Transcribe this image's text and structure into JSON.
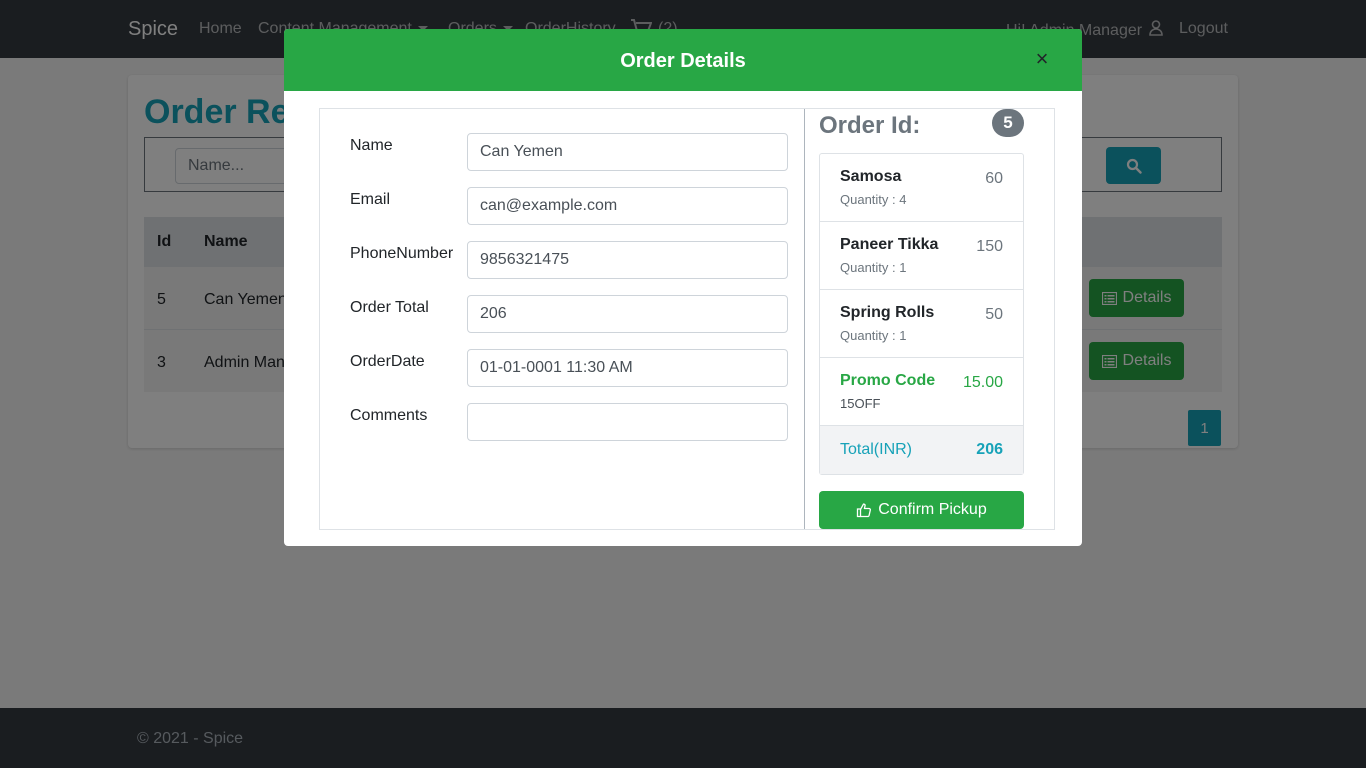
{
  "navbar": {
    "brand": "Spice",
    "links": [
      "Home",
      "Content Management",
      "Orders",
      "OrderHistory"
    ],
    "cart_count": "(2)",
    "user_greeting": "Hi! Admin Manager",
    "logout": "Logout"
  },
  "page": {
    "title": "Order Ready",
    "search_placeholder": "Name...",
    "table": {
      "headers": [
        "Id",
        "Name"
      ],
      "rows": [
        {
          "id": "5",
          "name": "Can Yemen",
          "action": "Details"
        },
        {
          "id": "3",
          "name": "Admin Manager",
          "action": "Details"
        }
      ]
    },
    "pagination": [
      "1"
    ]
  },
  "footer": {
    "text": "© 2021 - Spice"
  },
  "modal": {
    "title": "Order Details",
    "close": "×",
    "fields": [
      {
        "label": "Name",
        "value": "Can Yemen"
      },
      {
        "label": "Email",
        "value": "can@example.com"
      },
      {
        "label": "PhoneNumber",
        "value": "9856321475"
      },
      {
        "label": "Order Total",
        "value": "206"
      },
      {
        "label": "OrderDate",
        "value": "01-01-0001 11:30 AM"
      },
      {
        "label": "Comments",
        "value": ""
      }
    ],
    "order_id_label": "Order Id:",
    "order_id": "5",
    "items": [
      {
        "name": "Samosa",
        "quantity": "Quantity : 4",
        "price": "60"
      },
      {
        "name": "Paneer Tikka",
        "quantity": "Quantity : 1",
        "price": "150"
      },
      {
        "name": "Spring Rolls",
        "quantity": "Quantity : 1",
        "price": "50"
      }
    ],
    "promo": {
      "label": "Promo Code",
      "code": "15OFF",
      "value": "15.00"
    },
    "total": {
      "label": "Total(INR)",
      "value": "206"
    },
    "confirm_button": "Confirm Pickup"
  },
  "colors": {
    "primary_green": "#28a745",
    "info_teal": "#17a2b8",
    "navbar_dark": "#343a40",
    "badge_gray": "#6c757d"
  }
}
